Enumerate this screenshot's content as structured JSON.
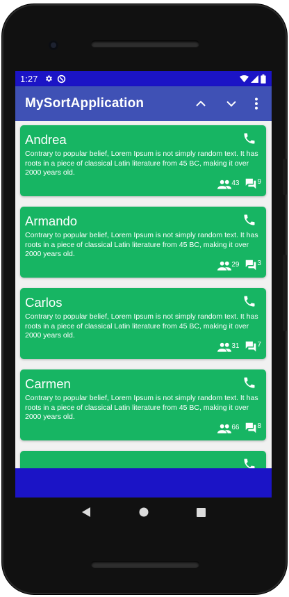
{
  "status_bar": {
    "time": "1:27",
    "icons_left": [
      "settings-icon",
      "sync-icon"
    ],
    "icons_right": [
      "wifi-icon",
      "signal-icon",
      "battery-icon"
    ]
  },
  "app_bar": {
    "title": "MySortApplication",
    "actions": [
      "sort-up-icon",
      "sort-down-icon",
      "more-vert-icon"
    ]
  },
  "contacts": [
    {
      "name": "Andrea",
      "description": "Contrary to popular belief, Lorem Ipsum is not simply random text. It has roots in a piece of classical Latin literature from 45 BC, making it over 2000 years old.",
      "people": "43",
      "messages": "9"
    },
    {
      "name": "Armando",
      "description": "Contrary to popular belief, Lorem Ipsum is not simply random text. It has roots in a piece of classical Latin literature from 45 BC, making it over 2000 years old.",
      "people": "29",
      "messages": "3"
    },
    {
      "name": "Carlos",
      "description": "Contrary to popular belief, Lorem Ipsum is not simply random text. It has roots in a piece of classical Latin literature from 45 BC, making it over 2000 years old.",
      "people": "31",
      "messages": "7"
    },
    {
      "name": "Carmen",
      "description": "Contrary to popular belief, Lorem Ipsum is not simply random text. It has roots in a piece of classical Latin literature from 45 BC, making it over 2000 years old.",
      "people": "66",
      "messages": "8"
    }
  ],
  "colors": {
    "status_bar": "#1b14c6",
    "app_bar": "#3f51b5",
    "card": "#17b563",
    "list_background": "#f1f1f1",
    "bottom_bar": "#1b14c6"
  },
  "nav_bar": [
    "back-icon",
    "home-icon",
    "recents-icon"
  ]
}
